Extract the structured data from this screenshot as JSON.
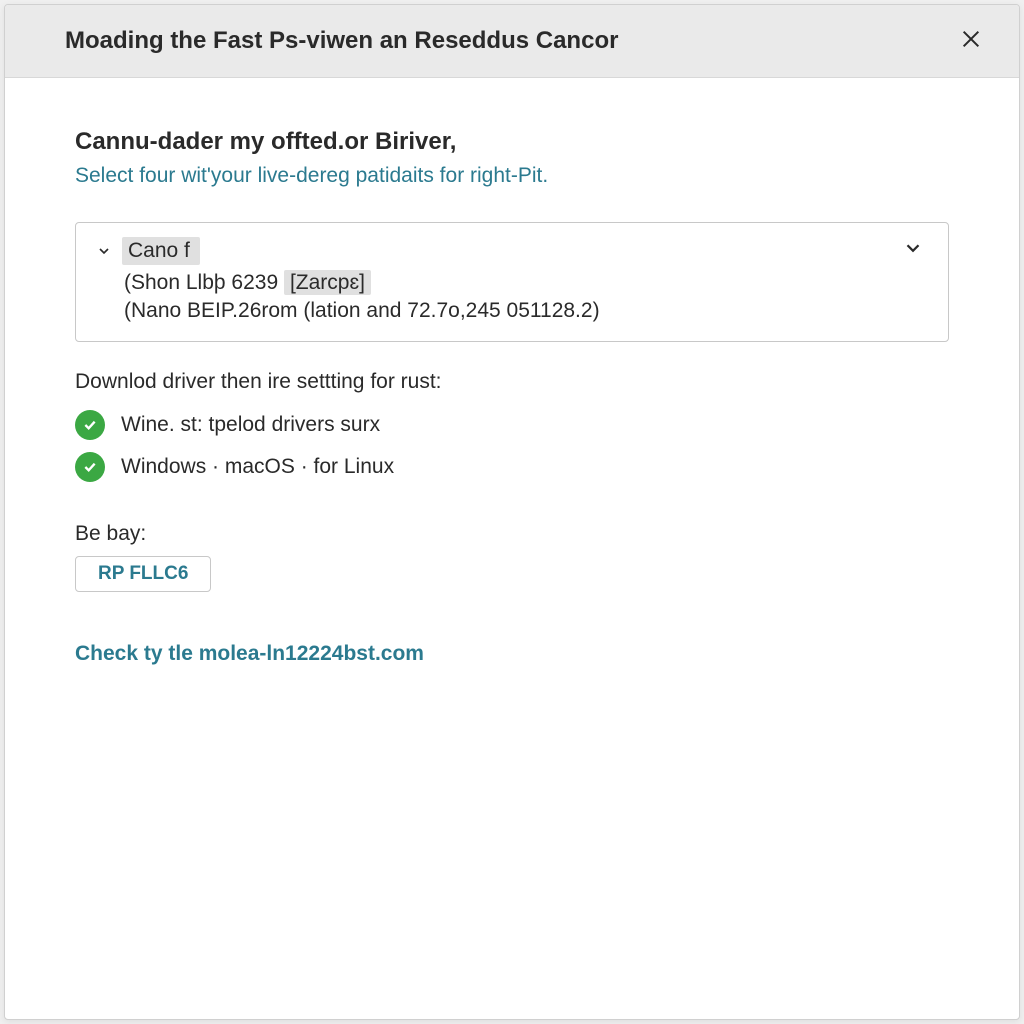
{
  "dialog": {
    "title": "Moading the Fast Ps-viwen an Reseddus Cancor"
  },
  "content": {
    "heading": "Cannu-dader my offted.or Biriver,",
    "subheading": "Select four wit'your live-dereg patidaits for right-Pit.",
    "dropdown": {
      "selected": "Cano f",
      "line1_prefix": "(Shon Llbþ 6239 ",
      "line1_badge": "[Zarcpɛ]",
      "line2": "(Nano BEIP.26rom (lation and 72.7o,245 051128.2)"
    },
    "download_label": "Downlod driver then ire settting for rust:",
    "checks": [
      "Wine. st: tpelod drivers surx",
      "Windows · macOS · for Linux"
    ],
    "bebay_label": "Be bay:",
    "tag_button": "RP FLLC6",
    "footer_link": "Check ty tle molea-ln12224bst.com"
  }
}
